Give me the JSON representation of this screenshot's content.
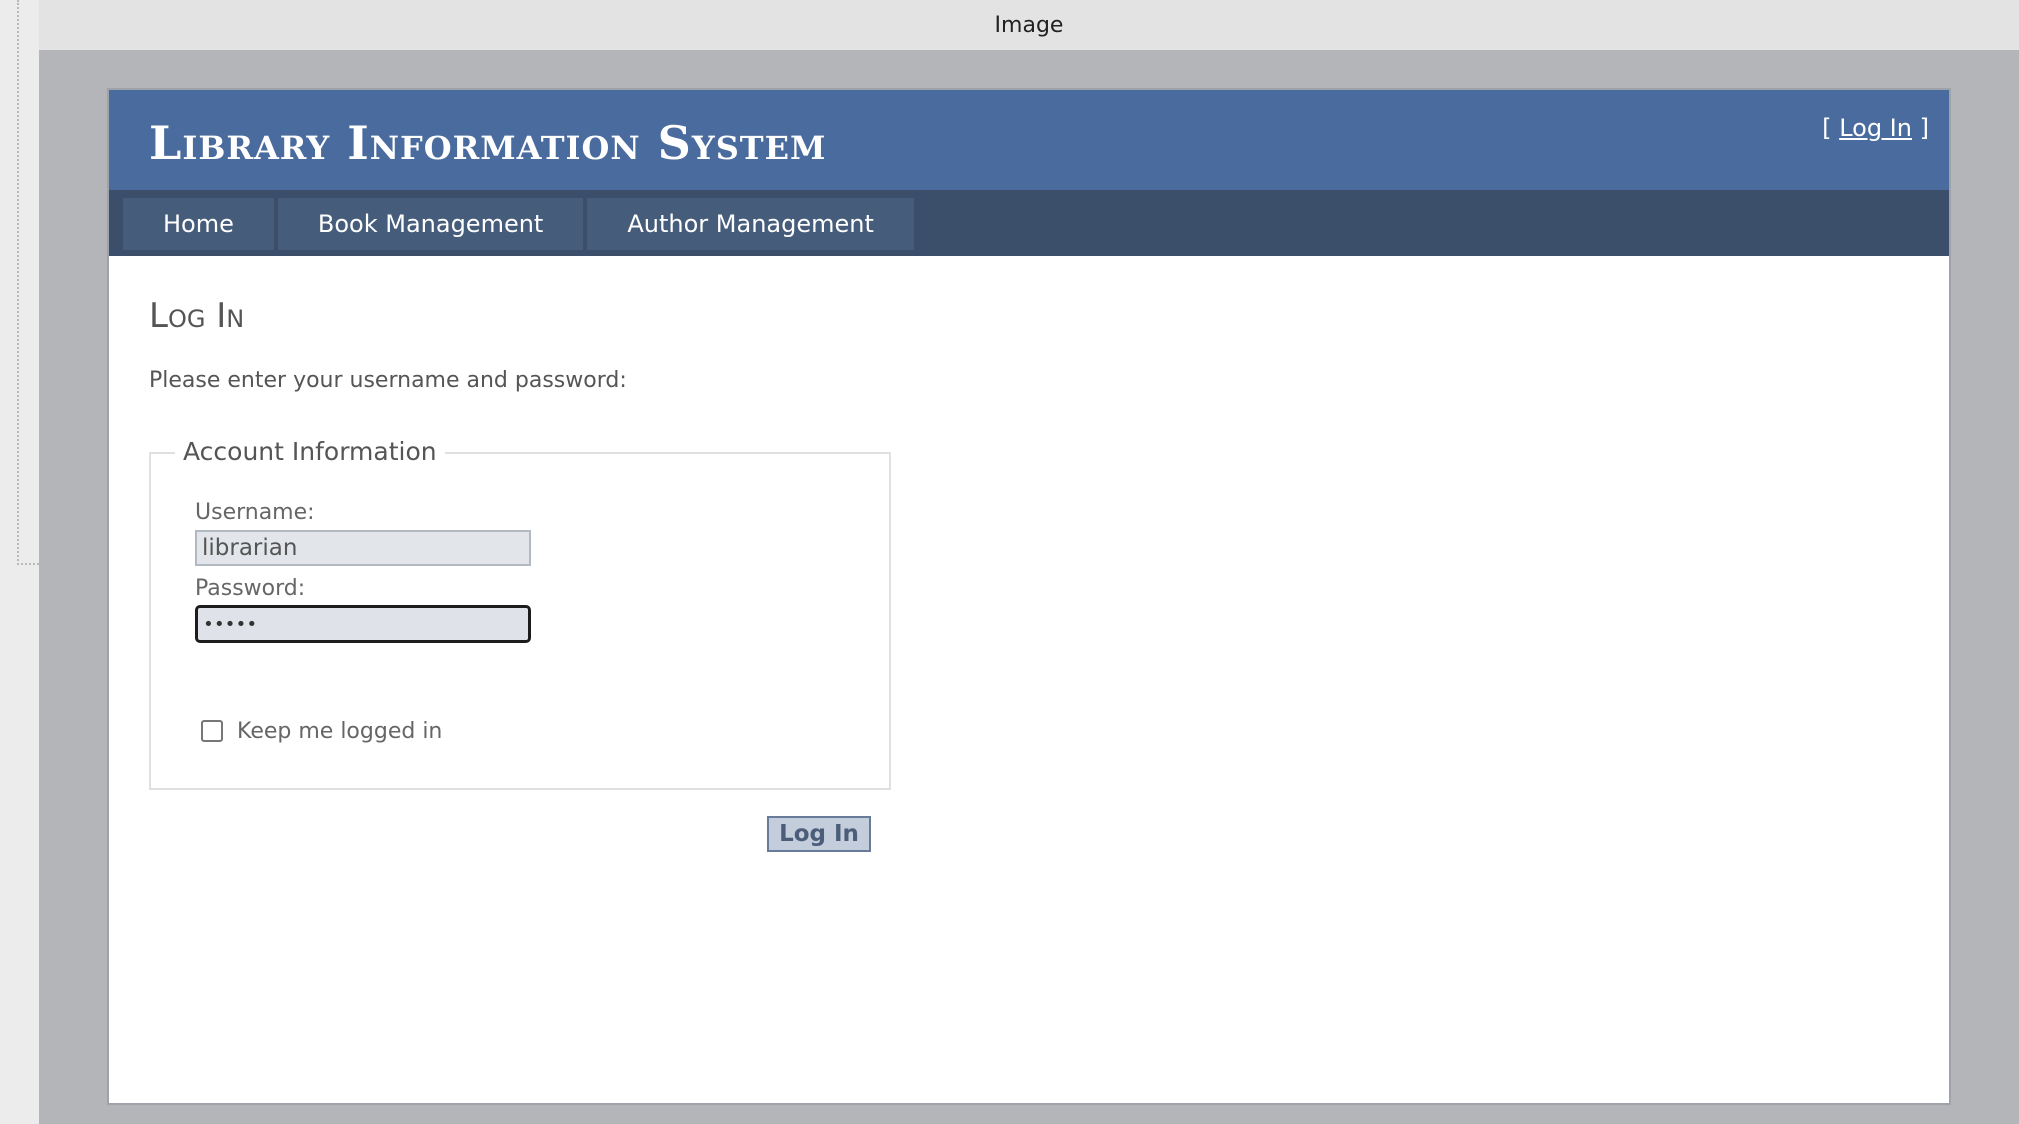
{
  "viewer": {
    "title": "Image"
  },
  "site": {
    "title": "Library Information System",
    "login_display": {
      "open_bracket": "[",
      "link_label": "Log In",
      "close_bracket": "]"
    }
  },
  "menu": {
    "items": [
      {
        "label": "Home"
      },
      {
        "label": "Book Management"
      },
      {
        "label": "Author Management"
      }
    ]
  },
  "login_form": {
    "heading": "Log In",
    "instruction": "Please enter your username and password:",
    "legend": "Account Information",
    "username": {
      "label": "Username:",
      "value": "librarian"
    },
    "password": {
      "label": "Password:",
      "value": "•••••"
    },
    "remember_me": {
      "label": "Keep me logged in",
      "checked": false
    },
    "submit_label": "Log In"
  },
  "colors": {
    "header": "#4a6b9d",
    "menu_bar": "#3b4f6b",
    "menu_item": "#465c7b",
    "canvas": "#b4b5b8",
    "button": "#c3cddb"
  },
  "icons": {
    "checkbox": "checkbox-unchecked-icon"
  }
}
